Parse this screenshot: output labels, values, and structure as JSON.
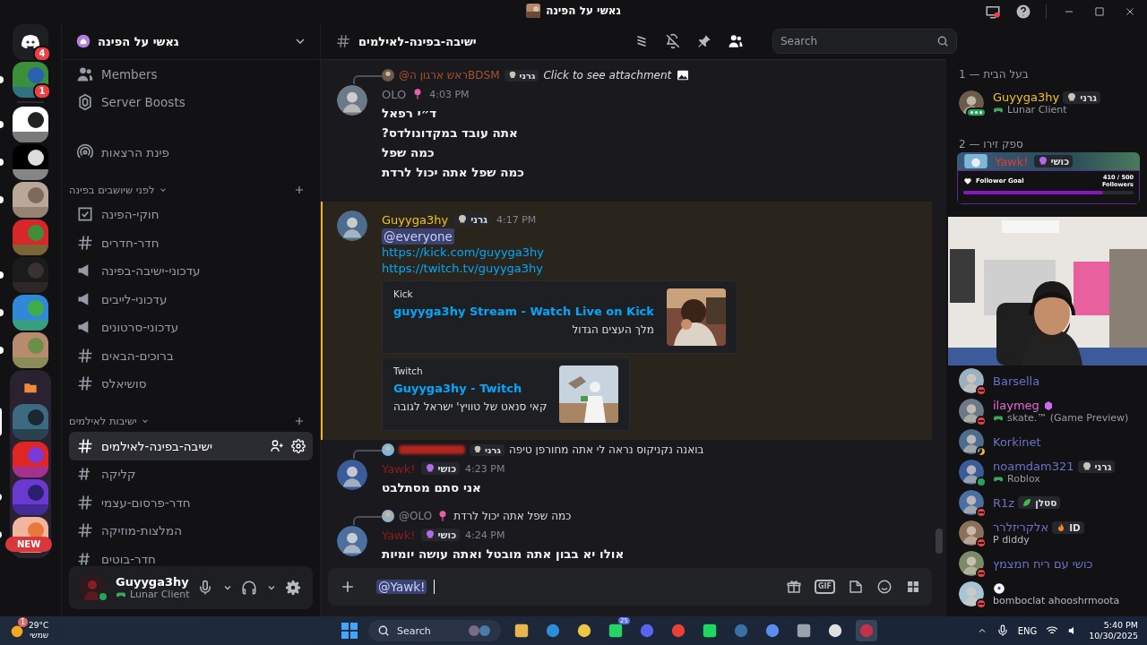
{
  "window": {
    "title": "גאשי על הפינה"
  },
  "servers": [
    {
      "kind": "home",
      "badge": "4",
      "unread": false,
      "selected": false
    },
    {
      "kind": "picture",
      "badge": "1",
      "unread": true,
      "selected": false
    },
    {
      "kind": "picture",
      "unread": true,
      "selected": false
    },
    {
      "kind": "picture",
      "unread": true,
      "selected": false
    },
    {
      "kind": "picture",
      "unread": true,
      "selected": false
    },
    {
      "kind": "picture",
      "unread": false,
      "selected": false
    },
    {
      "kind": "picture",
      "unread": true,
      "selected": false
    },
    {
      "kind": "picture",
      "unread": true,
      "selected": false
    },
    {
      "kind": "picture",
      "unread": true,
      "selected": false
    },
    {
      "kind": "folder",
      "children": [
        {
          "kind": "picture",
          "unread": false,
          "selected": true
        },
        {
          "kind": "picture",
          "unread": false,
          "selected": false
        },
        {
          "kind": "picture",
          "unread": true,
          "selected": false
        },
        {
          "kind": "picture",
          "unread": true,
          "selected": false
        }
      ]
    }
  ],
  "new_badge": "NEW",
  "server": {
    "name": "גאשי על הפינה"
  },
  "channels": [
    {
      "kind": "members",
      "name": "Members"
    },
    {
      "kind": "boosts",
      "name": "Server Boosts"
    },
    {
      "kind": "divider"
    },
    {
      "kind": "stage",
      "name": "פינת הרצאות"
    },
    {
      "kind": "category",
      "name": "לפני שיושבים בפינה"
    },
    {
      "kind": "rules",
      "name": "חוקי-הפינה",
      "selected": false
    },
    {
      "kind": "text",
      "name": "חדר-חדרים",
      "selected": false
    },
    {
      "kind": "announcement",
      "name": "עדכוני-ישיבה-בפינה",
      "selected": false
    },
    {
      "kind": "announcement",
      "name": "עדכוני-לייבים",
      "selected": false
    },
    {
      "kind": "announcement",
      "name": "עדכוני-סרטונים",
      "selected": false
    },
    {
      "kind": "text",
      "name": "ברוכים-הבאים",
      "selected": false
    },
    {
      "kind": "text",
      "name": "סושיאלס",
      "selected": false
    },
    {
      "kind": "category",
      "name": "ישיבות לאילמים"
    },
    {
      "kind": "text",
      "name": "ישיבה-בפינה-לאילמים",
      "selected": true
    },
    {
      "kind": "thread",
      "name": "קליקה",
      "selected": false
    },
    {
      "kind": "text",
      "name": "חדר-פרסום-עצמי",
      "selected": false
    },
    {
      "kind": "text",
      "name": "המלצות-מוזיקה",
      "selected": false
    },
    {
      "kind": "thread",
      "name": "חדר-בוטים",
      "selected": false
    }
  ],
  "user": {
    "name": "Guyyga3hy",
    "activity": "Lunar Client"
  },
  "header": {
    "channel": "ישיבה-בפינה-לאילמים",
    "search": {
      "placeholder": "Search"
    }
  },
  "messages": [
    {
      "reply": {
        "author": "@ראש ארגון הBDSM",
        "color": "#a4532e",
        "tag": {
          "label": "גרני",
          "kind": "skull"
        },
        "text": "Click to see attachment",
        "attachment": true
      },
      "author": "OLO",
      "color": "#80848e",
      "emoji": {
        "kind": "lollipop"
      },
      "time": "4:03 PM",
      "highlighted": false,
      "blocks": [
        {
          "kind": "text",
          "text": "ד״י רפאל"
        },
        {
          "kind": "text",
          "text": "אתה עובד במקדונולדס?"
        },
        {
          "kind": "text",
          "text": "כמה שפל"
        },
        {
          "kind": "text",
          "text": "כמה שפל אתה יכול לרדת"
        }
      ]
    },
    {
      "author": "Guyyga3hy",
      "color": "#f0c419",
      "tag": {
        "label": "גרני",
        "kind": "skull"
      },
      "time": "4:17 PM",
      "highlighted": true,
      "blocks": [
        {
          "kind": "mention",
          "text": "@everyone"
        },
        {
          "kind": "link",
          "text": "https://kick.com/guyyga3hy"
        },
        {
          "kind": "link",
          "text": "https://twitch.tv/guyyga3hy"
        },
        {
          "kind": "embed",
          "provider": "Kick",
          "title": "guyyga3hy Stream - Watch Live on Kick",
          "description": "מלך העצים הגדול"
        },
        {
          "kind": "embed",
          "provider": "Twitch",
          "title": "Guyyga3hy - Twitch",
          "description": "קאי סנאט של טוויץ' ישראל לגובה"
        }
      ]
    },
    {
      "reply": {
        "redacted": true,
        "color": "#b3261e",
        "tag": {
          "label": "גרני",
          "kind": "skull"
        },
        "text": "בואנה נקניקוס נראה לי אתה מחורפן טיפה"
      },
      "author": "Yawk!",
      "color": "#8e1b1b",
      "tag": {
        "label": "כושי",
        "kind": "alien"
      },
      "time": "4:23 PM",
      "highlighted": false,
      "blocks": [
        {
          "kind": "text",
          "text": "אני סתם מסתלבט"
        }
      ]
    },
    {
      "reply": {
        "author": "@OLO",
        "color": "#80848e",
        "emoji": {
          "kind": "lollipop"
        },
        "text": "כמה שפל אתה יכול לרדת"
      },
      "author": "Yawk!",
      "color": "#8e1b1b",
      "tag": {
        "label": "כושי",
        "kind": "alien"
      },
      "time": "4:24 PM",
      "highlighted": false,
      "blocks": [
        {
          "kind": "text",
          "text": "אולו יא בבון אתה מובטל ואתה עושה יומיות"
        }
      ]
    }
  ],
  "composer": {
    "value": "@Yawk!",
    "gif_label": "GIF"
  },
  "member_groups": [
    {
      "title": "בעל הבית — 1",
      "members": [
        {
          "name": "Guyyga3hy",
          "color": "#f0c419",
          "status": {
            "kind": "typing"
          },
          "tag": {
            "label": "גרני",
            "kind": "skull"
          },
          "activity": "Lunar Client"
        }
      ]
    },
    {
      "title": "ספק זירו — 2",
      "featured": {
        "name": "Yawk!",
        "color": "#e53935",
        "tag": {
          "label": "כושי",
          "kind": "alien"
        },
        "widget": {
          "title": "Follower Goal",
          "count": "410 / 500",
          "unit": "Followers",
          "level": 0.82
        }
      },
      "members": [
        {
          "name": "Barsella",
          "color": "#6c70c9",
          "status": {
            "kind": "dnd"
          }
        },
        {
          "name": "ilaymeg",
          "color": "#e36ad6",
          "status": {
            "kind": "dnd"
          },
          "badge": {
            "kind": "gem"
          },
          "activity": "skate.™ (Game Preview)"
        },
        {
          "name": "Korkinet",
          "color": "#6c70c9",
          "status": {
            "kind": "idle"
          }
        },
        {
          "name": "noamdam321",
          "color": "#6c70c9",
          "status": {
            "kind": "online"
          },
          "tag": {
            "label": "גרני",
            "kind": "skull"
          },
          "activity": "Roblox"
        },
        {
          "name": "R1z",
          "color": "#6c70c9",
          "status": {
            "kind": "dnd"
          },
          "tag": {
            "label": "סטלן",
            "kind": "leaf"
          }
        },
        {
          "name": "אלקריזלרר",
          "color": "#6c70c9",
          "status": {
            "kind": "dnd"
          },
          "tag": {
            "label": "ID",
            "kind": "flame"
          },
          "activity": "P diddy",
          "activity_plain": true
        },
        {
          "name": "כושי עם ריח חמצמץ",
          "color": "#6c70c9",
          "status": {
            "kind": "dnd"
          }
        },
        {
          "emoji": {
            "kind": "ball"
          },
          "status": {
            "kind": "dnd"
          },
          "activity": "bomboclat ahooshrmoota",
          "activity_plain": true
        }
      ]
    }
  ],
  "taskbar": {
    "weather": {
      "temp": "29°C",
      "condition": "שמשי",
      "badge": "1"
    },
    "search": {
      "placeholder": "Search"
    },
    "app_badge": "25",
    "language": "ENG",
    "time": "5:40 PM",
    "date": "10/30/2025"
  }
}
